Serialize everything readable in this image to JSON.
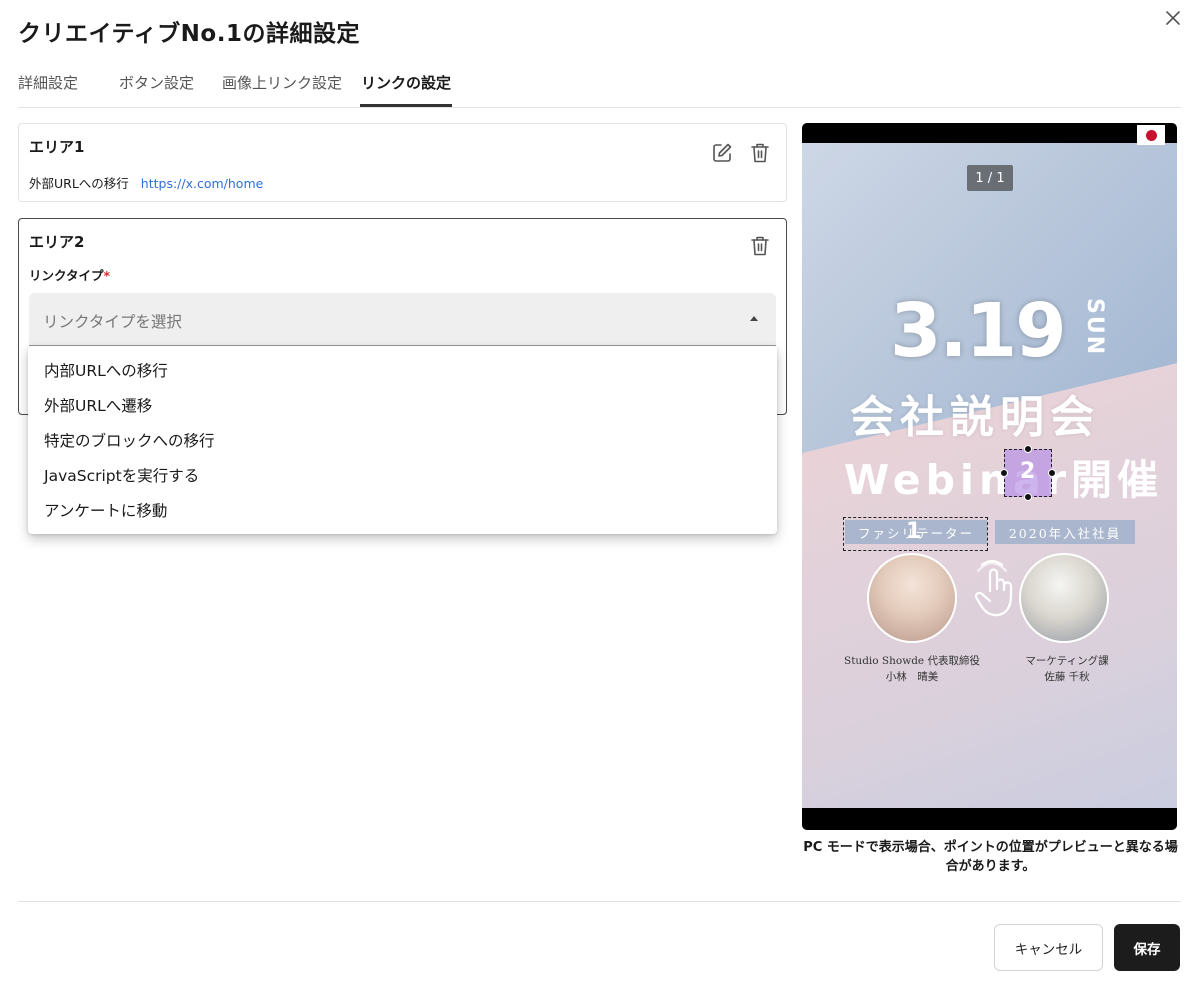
{
  "dialog": {
    "title": "クリエイティブNo.1の詳細設定"
  },
  "tabs": [
    {
      "label": "詳細設定",
      "active": false
    },
    {
      "label": "ボタン設定",
      "active": false
    },
    {
      "label": "画像上リンク設定",
      "active": false
    },
    {
      "label": "リンクの設定",
      "active": true
    }
  ],
  "areas": [
    {
      "title": "エリア1",
      "link_type": "外部URLへの移行",
      "link_url": "https://x.com/home"
    },
    {
      "title": "エリア2",
      "field_label": "リンクタイプ",
      "required_mark": "*",
      "select_placeholder": "リンクタイプを選択"
    }
  ],
  "dropdown_options": [
    "内部URLへの移行",
    "外部URLへ遷移",
    "特定のブロックへの移行",
    "JavaScriptを実行する",
    "アンケートに移動"
  ],
  "preview": {
    "counter": "1 / 1",
    "date": "3.19",
    "day": "SUN",
    "headline": "会社説明会",
    "subheadline": "Webinar開催",
    "tag1": "ファシリテーター",
    "tag2": "2020年入社社員",
    "person1_line1": "Studio Showde 代表取締役",
    "person1_line2": "小林　晴美",
    "person2_line1": "マーケティング課",
    "person2_line2": "佐藤 千秋",
    "area1_number": "1",
    "area2_number": "2"
  },
  "note": "PC モードで表示場合、ポイントの位置がプレビューと異なる場合があります。",
  "footer": {
    "cancel_label": "キャンセル",
    "save_label": "保存"
  },
  "colors": {
    "link": "#2f6fd6",
    "required": "#d32f2f",
    "primary_button": "#1c1c1c"
  }
}
